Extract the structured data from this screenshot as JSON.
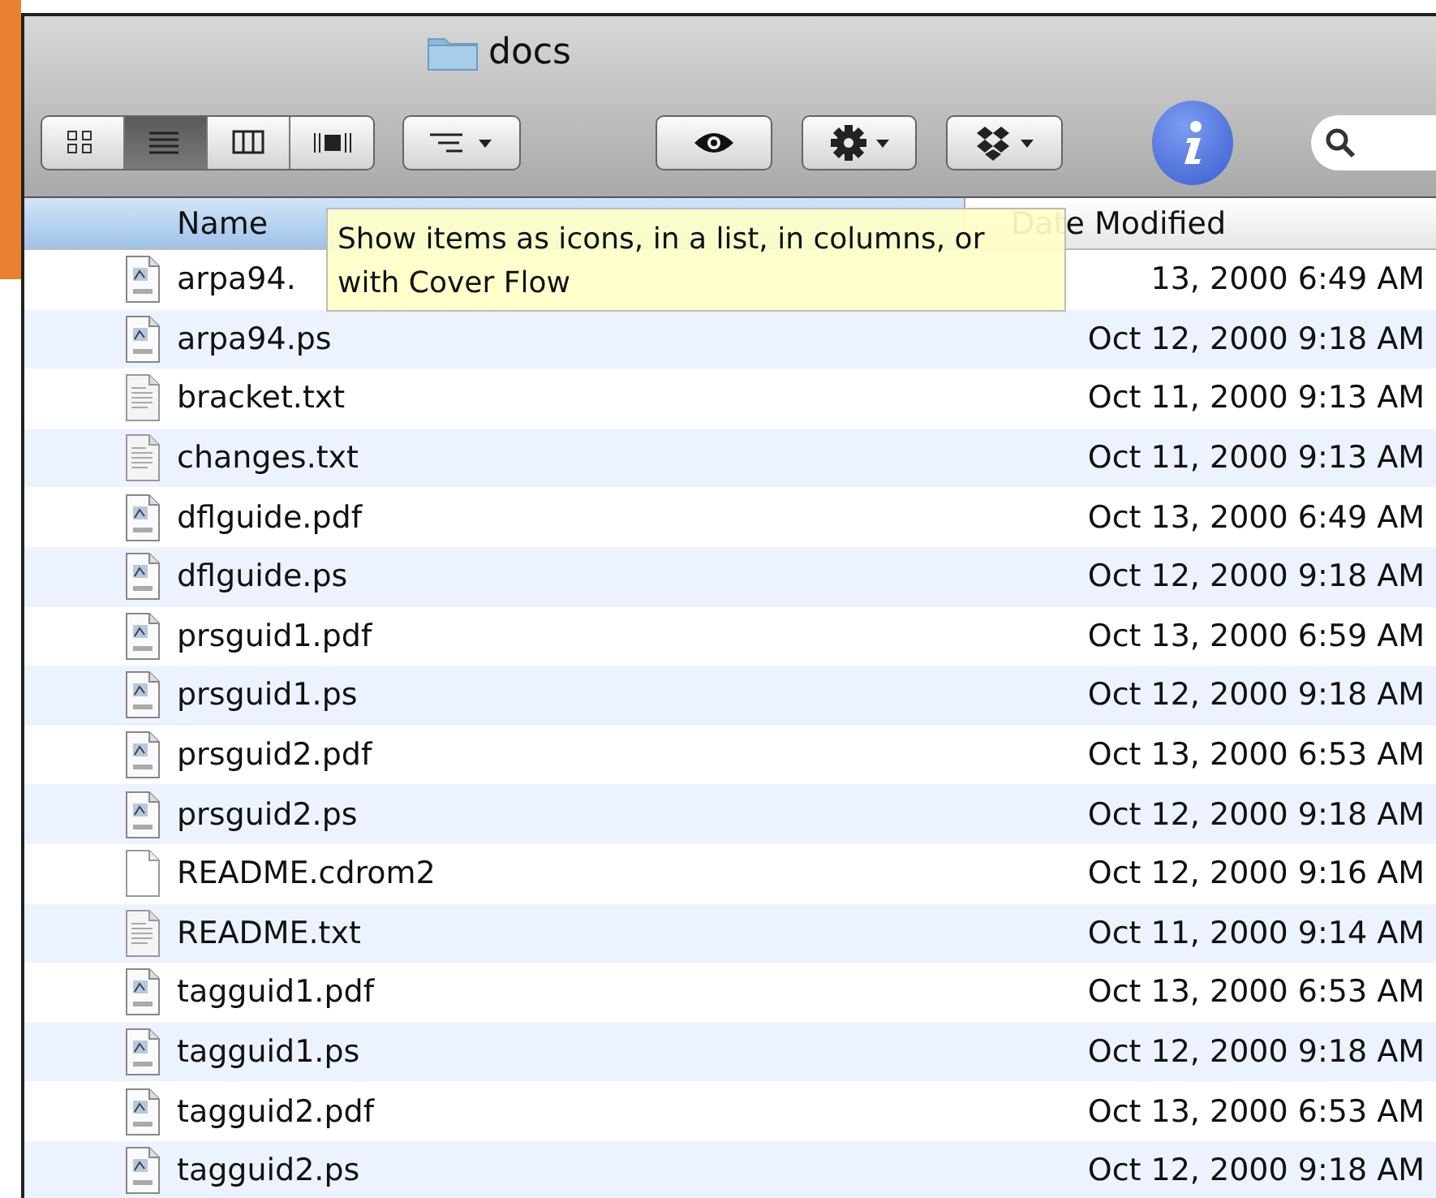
{
  "window": {
    "title": "docs"
  },
  "toolbar": {
    "view_modes": [
      {
        "kind": "icons",
        "selected": false
      },
      {
        "kind": "list",
        "selected": true
      },
      {
        "kind": "columns",
        "selected": false
      },
      {
        "kind": "coverflow",
        "selected": false
      }
    ],
    "buttons": [
      {
        "kind": "arrange"
      },
      {
        "kind": "quicklook"
      },
      {
        "kind": "action"
      },
      {
        "kind": "dropbox"
      },
      {
        "kind": "info"
      },
      {
        "kind": "search"
      }
    ]
  },
  "columns": [
    {
      "label": "Name",
      "selected": true
    },
    {
      "label": "Date Modified",
      "selected": false
    }
  ],
  "tooltip": {
    "text": "Show items as icons, in a list, in columns, or with Cover Flow"
  },
  "files": [
    {
      "name": "arpa94.",
      "kind": "preview",
      "date": "13, 2000 6:49 AM"
    },
    {
      "name": "arpa94.ps",
      "kind": "preview",
      "date": "Oct 12, 2000 9:18 AM"
    },
    {
      "name": "bracket.txt",
      "kind": "text",
      "date": "Oct 11, 2000 9:13 AM"
    },
    {
      "name": "changes.txt",
      "kind": "text",
      "date": "Oct 11, 2000 9:13 AM"
    },
    {
      "name": "dflguide.pdf",
      "kind": "preview",
      "date": "Oct 13, 2000 6:49 AM"
    },
    {
      "name": "dflguide.ps",
      "kind": "preview",
      "date": "Oct 12, 2000 9:18 AM"
    },
    {
      "name": "prsguid1.pdf",
      "kind": "preview",
      "date": "Oct 13, 2000 6:59 AM"
    },
    {
      "name": "prsguid1.ps",
      "kind": "preview",
      "date": "Oct 12, 2000 9:18 AM"
    },
    {
      "name": "prsguid2.pdf",
      "kind": "preview",
      "date": "Oct 13, 2000 6:53 AM"
    },
    {
      "name": "prsguid2.ps",
      "kind": "preview",
      "date": "Oct 12, 2000 9:18 AM"
    },
    {
      "name": "README.cdrom2",
      "kind": "blank",
      "date": "Oct 12, 2000 9:16 AM"
    },
    {
      "name": "README.txt",
      "kind": "text",
      "date": "Oct 11, 2000 9:14 AM"
    },
    {
      "name": "tagguid1.pdf",
      "kind": "preview",
      "date": "Oct 13, 2000 6:53 AM"
    },
    {
      "name": "tagguid1.ps",
      "kind": "preview",
      "date": "Oct 12, 2000 9:18 AM"
    },
    {
      "name": "tagguid2.pdf",
      "kind": "preview",
      "date": "Oct 13, 2000 6:53 AM"
    },
    {
      "name": "tagguid2.ps",
      "kind": "preview",
      "date": "Oct 12, 2000 9:18 AM"
    }
  ]
}
